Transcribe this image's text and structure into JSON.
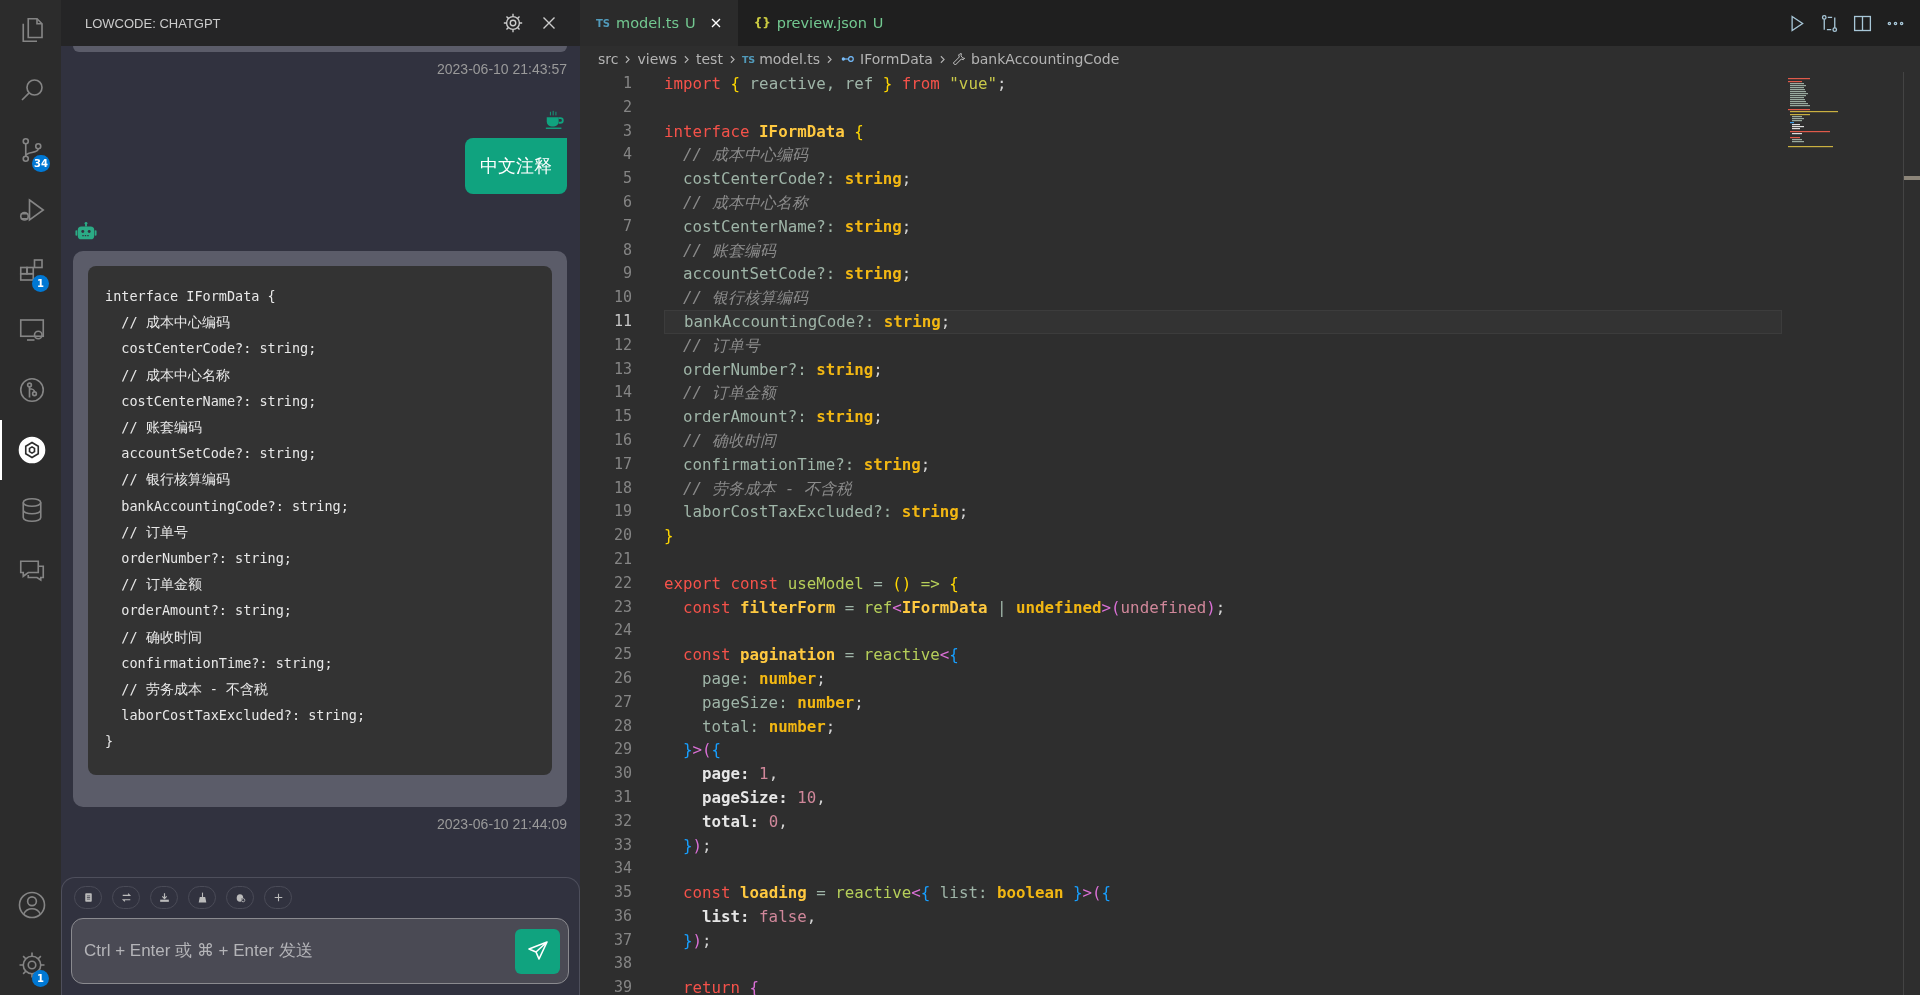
{
  "activity_bar": {
    "items": [
      {
        "kind": "files",
        "selected": false
      },
      {
        "kind": "search",
        "selected": false
      },
      {
        "kind": "branch",
        "selected": false,
        "badge": "34"
      },
      {
        "kind": "runbug",
        "selected": false
      },
      {
        "kind": "blocks",
        "selected": false,
        "badge": "1"
      },
      {
        "kind": "monitor",
        "selected": false
      },
      {
        "kind": "graph",
        "selected": false
      },
      {
        "kind": "hexagon",
        "selected": true
      },
      {
        "kind": "database",
        "selected": false
      },
      {
        "kind": "chat",
        "selected": false
      }
    ],
    "bottom_items": [
      {
        "kind": "user",
        "selected": false
      },
      {
        "kind": "gear",
        "selected": false,
        "badge": "1"
      }
    ]
  },
  "chat_panel": {
    "title": "LOWCODE: CHATGPT",
    "messages": [
      {
        "kind": "clipped",
        "timestamp": "2023-06-10 21:43:57"
      },
      {
        "kind": "user",
        "text": "中文注释"
      },
      {
        "kind": "bot",
        "code": "interface IFormData {\n  // 成本中心编码\n  costCenterCode?: string;\n  // 成本中心名称\n  costCenterName?: string;\n  // 账套编码\n  accountSetCode?: string;\n  // 银行核算编码\n  bankAccountingCode?: string;\n  // 订单号\n  orderNumber?: string;\n  // 订单金额\n  orderAmount?: string;\n  // 确收时间\n  confirmationTime?: string;\n  // 劳务成本 - 不含税\n  laborCostTaxExcluded?: string;\n}",
        "timestamp": "2023-06-10 21:44:09"
      }
    ],
    "tools": [
      {
        "kind": "clipboard"
      },
      {
        "kind": "swap"
      },
      {
        "kind": "download"
      },
      {
        "kind": "broom"
      },
      {
        "kind": "bug"
      },
      {
        "kind": "plus"
      }
    ],
    "input": {
      "placeholder": "Ctrl + Enter 或 ⌘ + Enter 发送"
    }
  },
  "editor": {
    "tabs": [
      {
        "icon_text": "TS",
        "kind": "ts",
        "label": "model.ts",
        "status": "U",
        "selected": true
      },
      {
        "icon_text": "{}",
        "kind": "json",
        "label": "preview.json",
        "status": "U",
        "selected": false
      }
    ],
    "actions": [
      {
        "kind": "run"
      },
      {
        "kind": "compare"
      },
      {
        "kind": "split"
      },
      {
        "kind": "more"
      }
    ],
    "breadcrumb": [
      {
        "kind": "folder",
        "label": "src"
      },
      {
        "kind": "folder",
        "label": "views"
      },
      {
        "kind": "folder",
        "label": "test"
      },
      {
        "kind": "file",
        "icon_text": "TS",
        "label": "model.ts"
      },
      {
        "kind": "interface",
        "label": "IFormData"
      },
      {
        "kind": "property",
        "label": "bankAccountingCode"
      }
    ],
    "lines": [
      {
        "number": "1",
        "current": false,
        "tokens": [
          {
            "text": "import ",
            "kind": "kw"
          },
          {
            "text": "{",
            "kind": "b1"
          },
          {
            "text": " reactive, ref ",
            "kind": "id"
          },
          {
            "text": "}",
            "kind": "b1"
          },
          {
            "text": " from ",
            "kind": "kw"
          },
          {
            "text": "\"vue\"",
            "kind": "str"
          },
          {
            "text": ";",
            "kind": "punc"
          }
        ]
      },
      {
        "number": "2",
        "current": false
      },
      {
        "number": "3",
        "current": false,
        "tokens": [
          {
            "text": "interface ",
            "kind": "kw"
          },
          {
            "text": "IFormData ",
            "kind": "cls"
          },
          {
            "text": "{",
            "kind": "b1"
          }
        ]
      },
      {
        "number": "4",
        "current": false,
        "tokens": [
          {
            "text": "  // 成本中心编码",
            "kind": "cmt"
          }
        ]
      },
      {
        "number": "5",
        "current": false,
        "tokens": [
          {
            "text": "  costCenterCode?: ",
            "kind": "id"
          },
          {
            "text": "string",
            "kind": "type"
          },
          {
            "text": ";",
            "kind": "punc"
          }
        ]
      },
      {
        "number": "6",
        "current": false,
        "tokens": [
          {
            "text": "  // 成本中心名称",
            "kind": "cmt"
          }
        ]
      },
      {
        "number": "7",
        "current": false,
        "tokens": [
          {
            "text": "  costCenterName?: ",
            "kind": "id"
          },
          {
            "text": "string",
            "kind": "type"
          },
          {
            "text": ";",
            "kind": "punc"
          }
        ]
      },
      {
        "number": "8",
        "current": false,
        "tokens": [
          {
            "text": "  // 账套编码",
            "kind": "cmt"
          }
        ]
      },
      {
        "number": "9",
        "current": false,
        "tokens": [
          {
            "text": "  accountSetCode?: ",
            "kind": "id"
          },
          {
            "text": "string",
            "kind": "type"
          },
          {
            "text": ";",
            "kind": "punc"
          }
        ]
      },
      {
        "number": "10",
        "current": false,
        "tokens": [
          {
            "text": "  // 银行核算编码",
            "kind": "cmt"
          }
        ]
      },
      {
        "number": "11",
        "current": true,
        "tokens": [
          {
            "text": "  bankAccountingCode?: ",
            "kind": "id"
          },
          {
            "text": "string",
            "kind": "type"
          },
          {
            "text": ";",
            "kind": "punc"
          }
        ]
      },
      {
        "number": "12",
        "current": false,
        "tokens": [
          {
            "text": "  // 订单号",
            "kind": "cmt"
          }
        ]
      },
      {
        "number": "13",
        "current": false,
        "tokens": [
          {
            "text": "  orderNumber?: ",
            "kind": "id"
          },
          {
            "text": "string",
            "kind": "type"
          },
          {
            "text": ";",
            "kind": "punc"
          }
        ]
      },
      {
        "number": "14",
        "current": false,
        "tokens": [
          {
            "text": "  // 订单金额",
            "kind": "cmt"
          }
        ]
      },
      {
        "number": "15",
        "current": false,
        "tokens": [
          {
            "text": "  orderAmount?: ",
            "kind": "id"
          },
          {
            "text": "string",
            "kind": "type"
          },
          {
            "text": ";",
            "kind": "punc"
          }
        ]
      },
      {
        "number": "16",
        "current": false,
        "tokens": [
          {
            "text": "  // 确收时间",
            "kind": "cmt"
          }
        ]
      },
      {
        "number": "17",
        "current": false,
        "tokens": [
          {
            "text": "  confirmationTime?: ",
            "kind": "id"
          },
          {
            "text": "string",
            "kind": "type"
          },
          {
            "text": ";",
            "kind": "punc"
          }
        ]
      },
      {
        "number": "18",
        "current": false,
        "tokens": [
          {
            "text": "  // 劳务成本 - 不含税",
            "kind": "cmt"
          }
        ]
      },
      {
        "number": "19",
        "current": false,
        "tokens": [
          {
            "text": "  laborCostTaxExcluded?: ",
            "kind": "id"
          },
          {
            "text": "string",
            "kind": "type"
          },
          {
            "text": ";",
            "kind": "punc"
          }
        ]
      },
      {
        "number": "20",
        "current": false,
        "tokens": [
          {
            "text": "}",
            "kind": "b1"
          }
        ]
      },
      {
        "number": "21",
        "current": false
      },
      {
        "number": "22",
        "current": false,
        "tokens": [
          {
            "text": "export const ",
            "kind": "kw"
          },
          {
            "text": "useModel",
            "kind": "fn"
          },
          {
            "text": " = ",
            "kind": "op"
          },
          {
            "text": "()",
            "kind": "b1"
          },
          {
            "text": " => ",
            "kind": "fn"
          },
          {
            "text": "{",
            "kind": "b1"
          }
        ]
      },
      {
        "number": "23",
        "current": false,
        "tokens": [
          {
            "text": "  const ",
            "kind": "kw"
          },
          {
            "text": "filterForm",
            "kind": "cls"
          },
          {
            "text": " = ",
            "kind": "op"
          },
          {
            "text": "ref",
            "kind": "fn"
          },
          {
            "text": "<",
            "kind": "b2"
          },
          {
            "text": "IFormData",
            "kind": "cls"
          },
          {
            "text": " | ",
            "kind": "op"
          },
          {
            "text": "undefined",
            "kind": "type"
          },
          {
            "text": ">(",
            "kind": "b2"
          },
          {
            "text": "undefined",
            "kind": "num"
          },
          {
            "text": ")",
            "kind": "b2"
          },
          {
            "text": ";",
            "kind": "punc"
          }
        ]
      },
      {
        "number": "24",
        "current": false
      },
      {
        "number": "25",
        "current": false,
        "tokens": [
          {
            "text": "  const ",
            "kind": "kw"
          },
          {
            "text": "pagination",
            "kind": "cls"
          },
          {
            "text": " = ",
            "kind": "op"
          },
          {
            "text": "reactive",
            "kind": "fn"
          },
          {
            "text": "<",
            "kind": "b2"
          },
          {
            "text": "{",
            "kind": "b3"
          }
        ]
      },
      {
        "number": "26",
        "current": false,
        "tokens": [
          {
            "text": "    page: ",
            "kind": "id"
          },
          {
            "text": "number",
            "kind": "type"
          },
          {
            "text": ";",
            "kind": "punc"
          }
        ]
      },
      {
        "number": "27",
        "current": false,
        "tokens": [
          {
            "text": "    pageSize: ",
            "kind": "id"
          },
          {
            "text": "number",
            "kind": "type"
          },
          {
            "text": ";",
            "kind": "punc"
          }
        ]
      },
      {
        "number": "28",
        "current": false,
        "tokens": [
          {
            "text": "    total: ",
            "kind": "id"
          },
          {
            "text": "number",
            "kind": "type"
          },
          {
            "text": ";",
            "kind": "punc"
          }
        ]
      },
      {
        "number": "29",
        "current": false,
        "tokens": [
          {
            "text": "  }",
            "kind": "b3"
          },
          {
            "text": ">(",
            "kind": "b2"
          },
          {
            "text": "{",
            "kind": "b3"
          }
        ]
      },
      {
        "number": "30",
        "current": false,
        "tokens": [
          {
            "text": "    page: ",
            "kind": "key"
          },
          {
            "text": "1",
            "kind": "num"
          },
          {
            "text": ",",
            "kind": "punc"
          }
        ]
      },
      {
        "number": "31",
        "current": false,
        "tokens": [
          {
            "text": "    pageSize: ",
            "kind": "key"
          },
          {
            "text": "10",
            "kind": "num"
          },
          {
            "text": ",",
            "kind": "punc"
          }
        ]
      },
      {
        "number": "32",
        "current": false,
        "tokens": [
          {
            "text": "    total: ",
            "kind": "key"
          },
          {
            "text": "0",
            "kind": "num"
          },
          {
            "text": ",",
            "kind": "punc"
          }
        ]
      },
      {
        "number": "33",
        "current": false,
        "tokens": [
          {
            "text": "  }",
            "kind": "b3"
          },
          {
            "text": ")",
            "kind": "b2"
          },
          {
            "text": ";",
            "kind": "punc"
          }
        ]
      },
      {
        "number": "34",
        "current": false
      },
      {
        "number": "35",
        "current": false,
        "tokens": [
          {
            "text": "  const ",
            "kind": "kw"
          },
          {
            "text": "loading",
            "kind": "cls"
          },
          {
            "text": " = ",
            "kind": "op"
          },
          {
            "text": "reactive",
            "kind": "fn"
          },
          {
            "text": "<",
            "kind": "b2"
          },
          {
            "text": "{",
            "kind": "b3"
          },
          {
            "text": " list: ",
            "kind": "id"
          },
          {
            "text": "boolean",
            "kind": "type"
          },
          {
            "text": " }",
            "kind": "b3"
          },
          {
            "text": ">(",
            "kind": "b2"
          },
          {
            "text": "{",
            "kind": "b3"
          }
        ]
      },
      {
        "number": "36",
        "current": false,
        "tokens": [
          {
            "text": "    list: ",
            "kind": "key"
          },
          {
            "text": "false",
            "kind": "num"
          },
          {
            "text": ",",
            "kind": "punc"
          }
        ]
      },
      {
        "number": "37",
        "current": false,
        "tokens": [
          {
            "text": "  }",
            "kind": "b3"
          },
          {
            "text": ")",
            "kind": "b2"
          },
          {
            "text": ";",
            "kind": "punc"
          }
        ]
      },
      {
        "number": "38",
        "current": false
      },
      {
        "number": "39",
        "current": false,
        "tokens": [
          {
            "text": "  return ",
            "kind": "kw"
          },
          {
            "text": "{",
            "kind": "b2"
          }
        ]
      }
    ]
  }
}
